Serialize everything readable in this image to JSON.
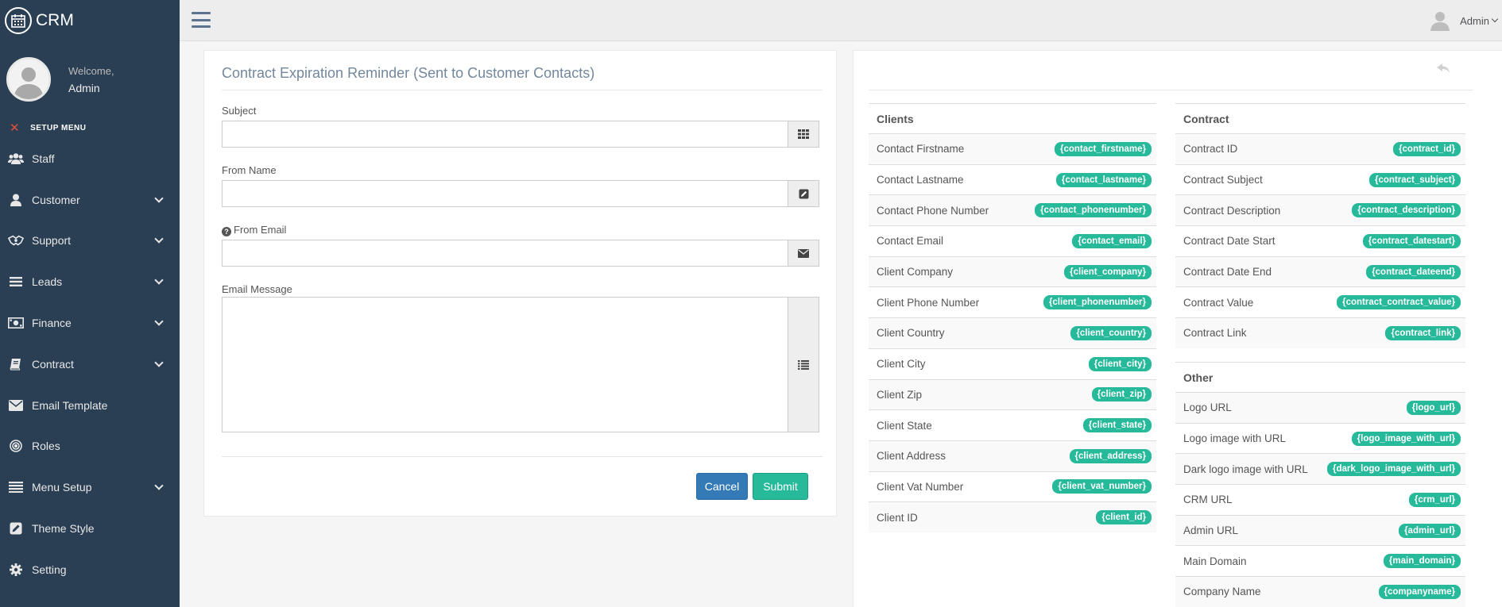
{
  "brand": {
    "name": "CRM"
  },
  "profile": {
    "welcome": "Welcome,",
    "user": "Admin"
  },
  "sidebar": {
    "section_label": "SETUP MENU",
    "items": [
      {
        "label": "Staff",
        "icon": "users-icon",
        "has_children": false
      },
      {
        "label": "Customer",
        "icon": "user-icon",
        "has_children": true
      },
      {
        "label": "Support",
        "icon": "support-icon",
        "has_children": true
      },
      {
        "label": "Leads",
        "icon": "bars-icon",
        "has_children": true
      },
      {
        "label": "Finance",
        "icon": "money-icon",
        "has_children": true
      },
      {
        "label": "Contract",
        "icon": "book-icon",
        "has_children": true
      },
      {
        "label": "Email Template",
        "icon": "envelope-icon",
        "has_children": false
      },
      {
        "label": "Roles",
        "icon": "bullseye-icon",
        "has_children": false
      },
      {
        "label": "Menu Setup",
        "icon": "list-icon",
        "has_children": true
      },
      {
        "label": "Theme Style",
        "icon": "edit-icon",
        "has_children": false
      },
      {
        "label": "Setting",
        "icon": "gear-icon",
        "has_children": false
      }
    ]
  },
  "topbar": {
    "user": "Admin"
  },
  "form": {
    "title": "Contract Expiration Reminder (Sent to Customer Contacts)",
    "subject_label": "Subject",
    "subject_value": "",
    "from_name_label": "From Name",
    "from_name_value": "",
    "from_email_label": "From Email",
    "from_email_value": "",
    "message_label": "Email Message",
    "message_value": "",
    "cancel_label": "Cancel",
    "submit_label": "Submit"
  },
  "merge_fields": {
    "clients": {
      "title": "Clients",
      "rows": [
        {
          "label": "Contact Firstname",
          "tag": "{contact_firstname}"
        },
        {
          "label": "Contact Lastname",
          "tag": "{contact_lastname}"
        },
        {
          "label": "Contact Phone Number",
          "tag": "{contact_phonenumber}"
        },
        {
          "label": "Contact Email",
          "tag": "{contact_email}"
        },
        {
          "label": "Client Company",
          "tag": "{client_company}"
        },
        {
          "label": "Client Phone Number",
          "tag": "{client_phonenumber}"
        },
        {
          "label": "Client Country",
          "tag": "{client_country}"
        },
        {
          "label": "Client City",
          "tag": "{client_city}"
        },
        {
          "label": "Client Zip",
          "tag": "{client_zip}"
        },
        {
          "label": "Client State",
          "tag": "{client_state}"
        },
        {
          "label": "Client Address",
          "tag": "{client_address}"
        },
        {
          "label": "Client Vat Number",
          "tag": "{client_vat_number}"
        },
        {
          "label": "Client ID",
          "tag": "{client_id}"
        }
      ]
    },
    "contract": {
      "title": "Contract",
      "rows": [
        {
          "label": "Contract ID",
          "tag": "{contract_id}"
        },
        {
          "label": "Contract Subject",
          "tag": "{contract_subject}"
        },
        {
          "label": "Contract Description",
          "tag": "{contract_description}"
        },
        {
          "label": "Contract Date Start",
          "tag": "{contract_datestart}"
        },
        {
          "label": "Contract Date End",
          "tag": "{contract_dateend}"
        },
        {
          "label": "Contract Value",
          "tag": "{contract_contract_value}"
        },
        {
          "label": "Contract Link",
          "tag": "{contract_link}"
        }
      ]
    },
    "other": {
      "title": "Other",
      "rows": [
        {
          "label": "Logo URL",
          "tag": "{logo_url}"
        },
        {
          "label": "Logo image with URL",
          "tag": "{logo_image_with_url}"
        },
        {
          "label": "Dark logo image with URL",
          "tag": "{dark_logo_image_with_url}"
        },
        {
          "label": "CRM URL",
          "tag": "{crm_url}"
        },
        {
          "label": "Admin URL",
          "tag": "{admin_url}"
        },
        {
          "label": "Main Domain",
          "tag": "{main_domain}"
        },
        {
          "label": "Company Name",
          "tag": "{companyname}"
        }
      ]
    }
  },
  "colors": {
    "sidebar": "#2a3f54",
    "accent": "#26b99a",
    "primary": "#337ab7"
  }
}
